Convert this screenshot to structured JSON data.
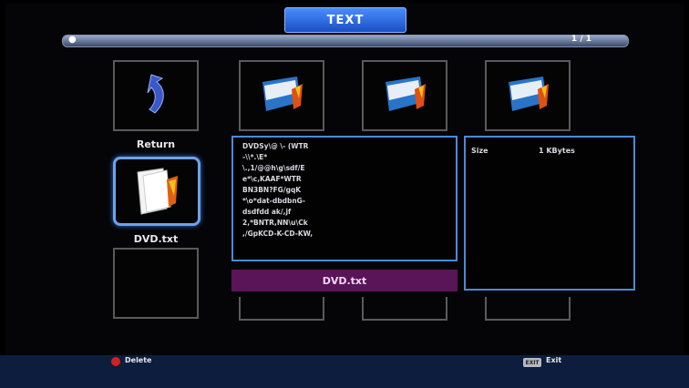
{
  "header": {
    "title": "TEXT"
  },
  "path_bar": {
    "page_indicator": "1 / 1"
  },
  "tiles": {
    "return_label": "Return",
    "selected_label": "DVD.txt"
  },
  "preview": {
    "lines": [
      "DVDSy\\@ \\- (WTR",
      "-\\\\*.\\E*",
      "\\.,1/@@h\\g\\sdf/E",
      "e*\\c,KAAF*WTR",
      "BN3BN?FG/gqK",
      "*\\o*dat-dbdbnG-",
      "dsdfdd ak/,jf",
      "2,*BNTR,NN\\u\\Ck",
      ",/GpKCD-K-CD-KW,"
    ]
  },
  "name_bar": {
    "filename": "DVD.txt"
  },
  "info": {
    "size_label": "Size",
    "size_value": "1 KBytes"
  },
  "footer": {
    "delete_label": "Delete",
    "exit_key": "EXIT",
    "exit_label": "Exit"
  },
  "colors": {
    "accent": "#2f6ee0",
    "name_bar": "#5a1458",
    "delete_key": "#d42020"
  }
}
